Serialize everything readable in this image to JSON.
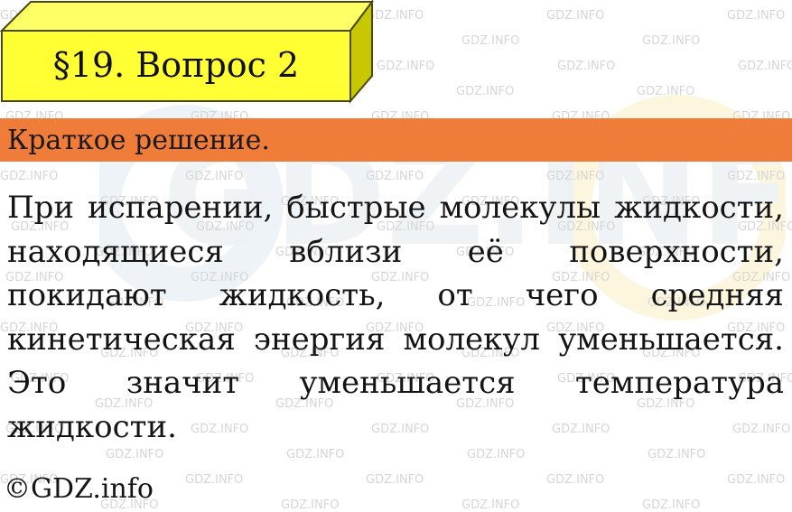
{
  "header": {
    "title": "§19. Вопрос 2"
  },
  "section": {
    "label": "Краткое решение."
  },
  "answer": {
    "text": "При испарении, быстрые молекулы жидкости, находящиеся вблизи её поверхности, покидают жидкость, от чего средняя кинетическая энергия молекул уменьшается. Это значит уменьшается температура жидкости."
  },
  "footer": {
    "copyright": "©GDZ.info"
  },
  "watermark": {
    "text": "GDZ.INFO"
  },
  "colors": {
    "header_fill": "#ffff33",
    "header_side": "#c8c800",
    "header_border": "#4a4a10",
    "section_bar": "#f07c3a",
    "watermark": "#d6d6d6"
  }
}
